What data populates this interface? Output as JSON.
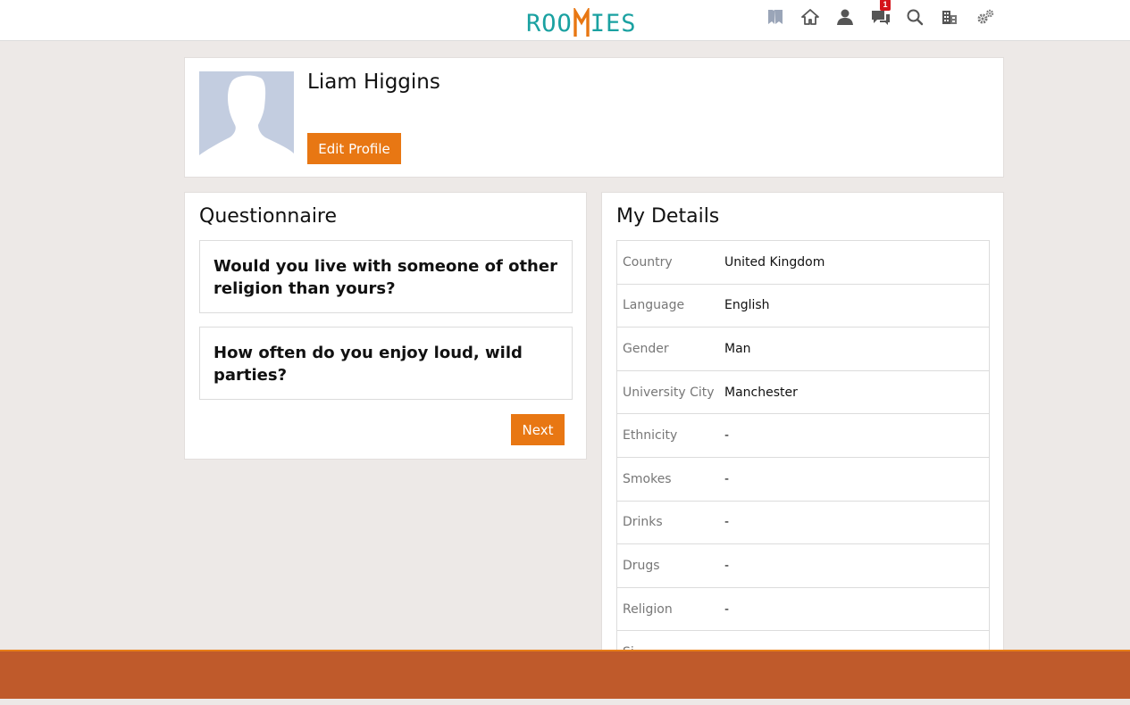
{
  "app": {
    "logo_left": "ROO",
    "logo_right": "IES",
    "brand_teal": "#1aa1a1",
    "brand_orange": "#e87713"
  },
  "nav": {
    "icons": [
      "bookmark-icon",
      "home-icon",
      "user-icon",
      "chat-icon",
      "search-icon",
      "building-icon",
      "settings-icon"
    ],
    "messages_badge": "1"
  },
  "profile": {
    "name": "Liam Higgins",
    "edit_label": "Edit Profile"
  },
  "questionnaire": {
    "title": "Questionnaire",
    "questions": [
      "Would you live with someone of other religion than yours?",
      "How often do you enjoy loud, wild parties?"
    ],
    "next_label": "Next"
  },
  "details": {
    "title": "My Details",
    "rows": [
      {
        "label": "Country",
        "value": "United Kingdom"
      },
      {
        "label": "Language",
        "value": "English"
      },
      {
        "label": "Gender",
        "value": "Man"
      },
      {
        "label": "University City",
        "value": "Manchester"
      },
      {
        "label": "Ethnicity",
        "value": "-"
      },
      {
        "label": "Smokes",
        "value": "-"
      },
      {
        "label": "Drinks",
        "value": "-"
      },
      {
        "label": "Drugs",
        "value": "-"
      },
      {
        "label": "Religion",
        "value": "-"
      },
      {
        "label": "Si",
        "value": ""
      }
    ]
  },
  "footer": {
    "color": "#bf5a2b"
  }
}
